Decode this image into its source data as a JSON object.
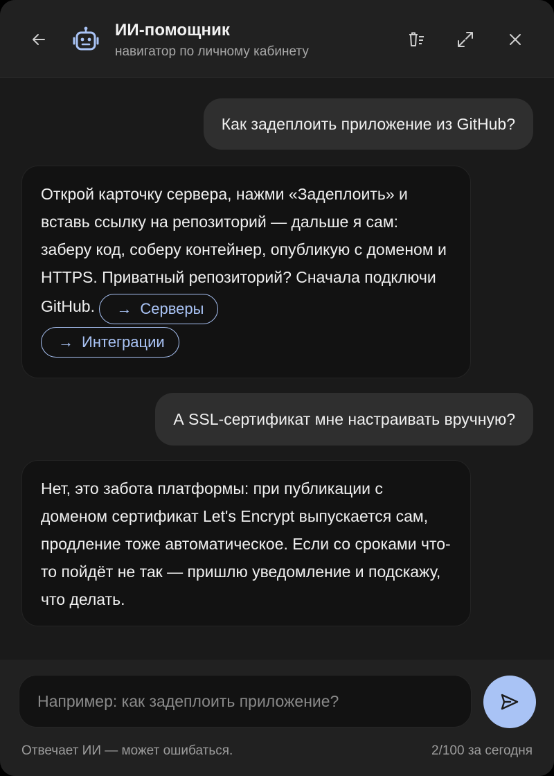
{
  "header": {
    "title": "ИИ-помощник",
    "subtitle": "навигатор по личному кабинету",
    "icons": [
      "arrow-left-icon",
      "robot-icon",
      "clear-history-icon",
      "expand-icon",
      "close-icon"
    ]
  },
  "messages": [
    {
      "role": "user",
      "text": "Как задеплоить приложение из GitHub?"
    },
    {
      "role": "assistant",
      "text": "Открой карточку сервера, нажми «Задеплоить» и вставь ссылку на репозиторий — дальше я сам: заберу код, соберу контейнер, опубликую с доменом и HTTPS. Приватный репозиторий? Сначала подключи GitHub.",
      "links": [
        {
          "icon": "→",
          "label": "Серверы"
        },
        {
          "icon": "→",
          "label": "Интеграции"
        }
      ]
    },
    {
      "role": "user",
      "text": "А SSL-сертификат мне настраивать вручную?"
    },
    {
      "role": "assistant",
      "text": "Нет, это забота платформы: при публикации с доменом сертификат Let's Encrypt выпускается сам, продление тоже автоматическое. Если со сроками что-то пойдёт не так — пришлю уведомление и подскажу, что делать."
    }
  ],
  "composer": {
    "placeholder": "Например: как задеплоить приложение?",
    "value": "",
    "send_icon": "send-icon",
    "disclaimer": "Отвечает ИИ — может ошибаться.",
    "usage": "2/100 за сегодня"
  },
  "colors": {
    "accent": "#a9c3f5",
    "background": "#1a1a1a",
    "user_bubble": "#2f2f2f",
    "assistant_bubble": "#121212"
  }
}
